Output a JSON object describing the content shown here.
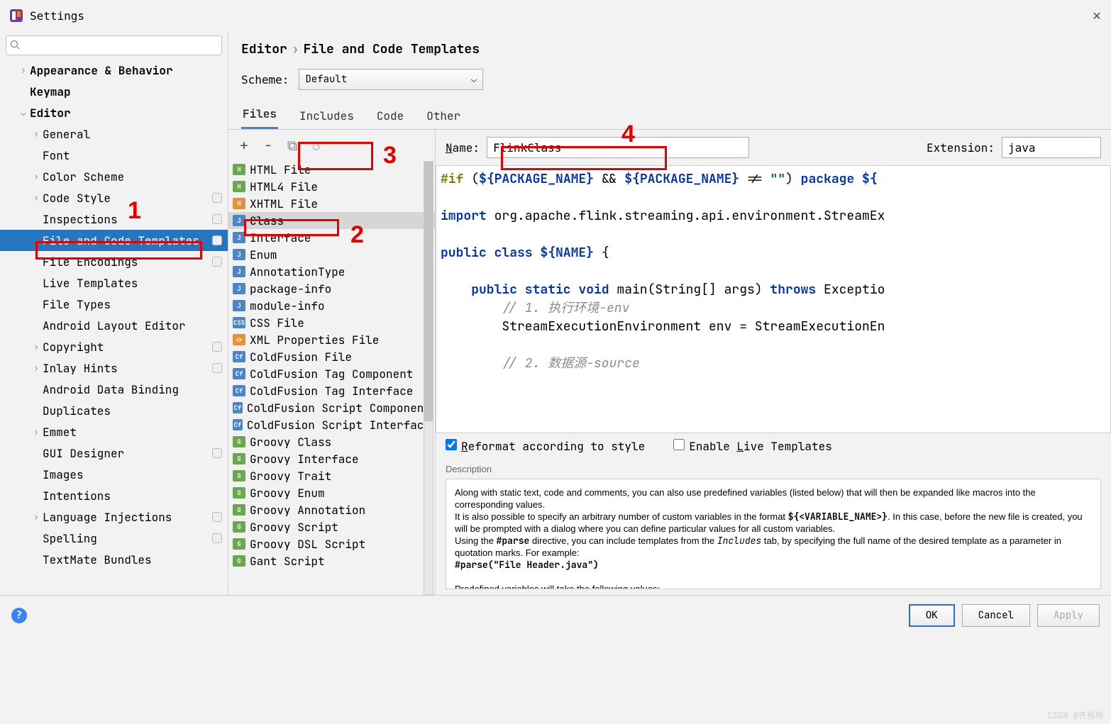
{
  "window": {
    "title": "Settings",
    "close_glyph": "✕"
  },
  "search": {
    "placeholder": ""
  },
  "breadcrumb": {
    "a": "Editor",
    "sep": "›",
    "b": "File and Code Templates"
  },
  "scheme": {
    "label": "Scheme:",
    "value": "Default"
  },
  "tabs": [
    "Files",
    "Includes",
    "Code",
    "Other"
  ],
  "toolbar_icons": {
    "add": "+",
    "remove": "−",
    "copy": "⧉",
    "undo": "↺"
  },
  "name_field": {
    "label_pre": "N",
    "label_rest": "ame:",
    "value": "FlinkClass"
  },
  "ext_field": {
    "label": "Extension:",
    "value": "java"
  },
  "checks": {
    "reformat_pre": "R",
    "reformat_rest": "eformat according to style",
    "reformat_checked": true,
    "live_pre": "L",
    "live_rest": "ive Templates",
    "live_label_prefix": "Enable ",
    "live_checked": false
  },
  "desc_label": "Description",
  "desc_lines": [
    "Along with static text, code and comments, you can also use predefined variables (listed below) that will then be expanded like macros into the corresponding values.",
    "It is also possible to specify an arbitrary number of custom variables in the format ${<VARIABLE_NAME>}. In this case, before the new file is created, you will be prompted with a dialog where you can define particular values for all custom variables.",
    "Using the #parse directive, you can include templates from the Includes tab, by specifying the full name of the desired template as a parameter in quotation marks. For example:",
    "#parse(\"File Header.java\")",
    "",
    "Predefined variables will take the following values:"
  ],
  "buttons": {
    "ok": "OK",
    "cancel": "Cancel",
    "apply": "Apply"
  },
  "sidebar": [
    {
      "indent": 1,
      "chev": "›",
      "label": "Appearance & Behavior",
      "bold": true
    },
    {
      "indent": 1,
      "chev": "",
      "label": "Keymap",
      "bold": true
    },
    {
      "indent": 1,
      "chev": "⌄",
      "label": "Editor",
      "bold": true
    },
    {
      "indent": 2,
      "chev": "›",
      "label": "General"
    },
    {
      "indent": 2,
      "chev": "",
      "label": "Font"
    },
    {
      "indent": 2,
      "chev": "›",
      "label": "Color Scheme"
    },
    {
      "indent": 2,
      "chev": "›",
      "label": "Code Style",
      "pill": true
    },
    {
      "indent": 2,
      "chev": "",
      "label": "Inspections",
      "pill": true
    },
    {
      "indent": 2,
      "chev": "",
      "label": "File and Code Templates",
      "pill": true,
      "selected": true
    },
    {
      "indent": 2,
      "chev": "",
      "label": "File Encodings",
      "pill": true
    },
    {
      "indent": 2,
      "chev": "",
      "label": "Live Templates"
    },
    {
      "indent": 2,
      "chev": "",
      "label": "File Types"
    },
    {
      "indent": 2,
      "chev": "",
      "label": "Android Layout Editor"
    },
    {
      "indent": 2,
      "chev": "›",
      "label": "Copyright",
      "pill": true
    },
    {
      "indent": 2,
      "chev": "›",
      "label": "Inlay Hints",
      "pill": true
    },
    {
      "indent": 2,
      "chev": "",
      "label": "Android Data Binding"
    },
    {
      "indent": 2,
      "chev": "",
      "label": "Duplicates"
    },
    {
      "indent": 2,
      "chev": "›",
      "label": "Emmet"
    },
    {
      "indent": 2,
      "chev": "",
      "label": "GUI Designer",
      "pill": true
    },
    {
      "indent": 2,
      "chev": "",
      "label": "Images"
    },
    {
      "indent": 2,
      "chev": "",
      "label": "Intentions"
    },
    {
      "indent": 2,
      "chev": "›",
      "label": "Language Injections",
      "pill": true
    },
    {
      "indent": 2,
      "chev": "",
      "label": "Spelling",
      "pill": true
    },
    {
      "indent": 2,
      "chev": "",
      "label": "TextMate Bundles"
    }
  ],
  "templates": [
    {
      "icon": "H",
      "color": "#6aa84f",
      "label": "HTML File"
    },
    {
      "icon": "H",
      "color": "#6aa84f",
      "label": "HTML4 File"
    },
    {
      "icon": "H",
      "color": "#e69138",
      "label": "XHTML File"
    },
    {
      "icon": "J",
      "color": "#4a86c7",
      "label": "Class",
      "selected": true
    },
    {
      "icon": "J",
      "color": "#4a86c7",
      "label": "Interface"
    },
    {
      "icon": "J",
      "color": "#4a86c7",
      "label": "Enum"
    },
    {
      "icon": "J",
      "color": "#4a86c7",
      "label": "AnnotationType"
    },
    {
      "icon": "J",
      "color": "#4a86c7",
      "label": "package-info"
    },
    {
      "icon": "J",
      "color": "#4a86c7",
      "label": "module-info"
    },
    {
      "icon": "CSS",
      "color": "#4a86c7",
      "label": "CSS File"
    },
    {
      "icon": "<>",
      "color": "#e69138",
      "label": "XML Properties File"
    },
    {
      "icon": "Cf",
      "color": "#4a86c7",
      "label": "ColdFusion File"
    },
    {
      "icon": "Cf",
      "color": "#4a86c7",
      "label": "ColdFusion Tag Component"
    },
    {
      "icon": "Cf",
      "color": "#4a86c7",
      "label": "ColdFusion Tag Interface"
    },
    {
      "icon": "Cf",
      "color": "#4a86c7",
      "label": "ColdFusion Script Component"
    },
    {
      "icon": "Cf",
      "color": "#4a86c7",
      "label": "ColdFusion Script Interface"
    },
    {
      "icon": "G",
      "color": "#6aa84f",
      "label": "Groovy Class"
    },
    {
      "icon": "G",
      "color": "#6aa84f",
      "label": "Groovy Interface"
    },
    {
      "icon": "G",
      "color": "#6aa84f",
      "label": "Groovy Trait"
    },
    {
      "icon": "G",
      "color": "#6aa84f",
      "label": "Groovy Enum"
    },
    {
      "icon": "G",
      "color": "#6aa84f",
      "label": "Groovy Annotation"
    },
    {
      "icon": "G",
      "color": "#6aa84f",
      "label": "Groovy Script"
    },
    {
      "icon": "G",
      "color": "#6aa84f",
      "label": "Groovy DSL Script"
    },
    {
      "icon": "G",
      "color": "#6aa84f",
      "label": "Gant Script"
    }
  ],
  "code": {
    "l1a": "#if",
    "l1b": " (",
    "l1c": "${PACKAGE_NAME}",
    "l1d": " && ",
    "l1e": "${PACKAGE_NAME}",
    "l1f": " != ",
    "l1g": "\"\"",
    "l1h": ") ",
    "l1i": "package",
    "l1j": " ${",
    "l2a": "import",
    "l2b": " org.apache.flink.streaming.api.environment.StreamEx",
    "l3a": "public class ",
    "l3b": "${NAME}",
    "l3c": " {",
    "l4a": "    public static void",
    "l4b": " main(String[] args) ",
    "l4c": "throws",
    "l4d": " Exceptio",
    "l5": "        // 1. 执行环境-env",
    "l6": "        StreamExecutionEnvironment env = StreamExecutionEn",
    "l7": "        // 2. 数据源-source"
  },
  "watermark": "CSDN @齐栋栋"
}
